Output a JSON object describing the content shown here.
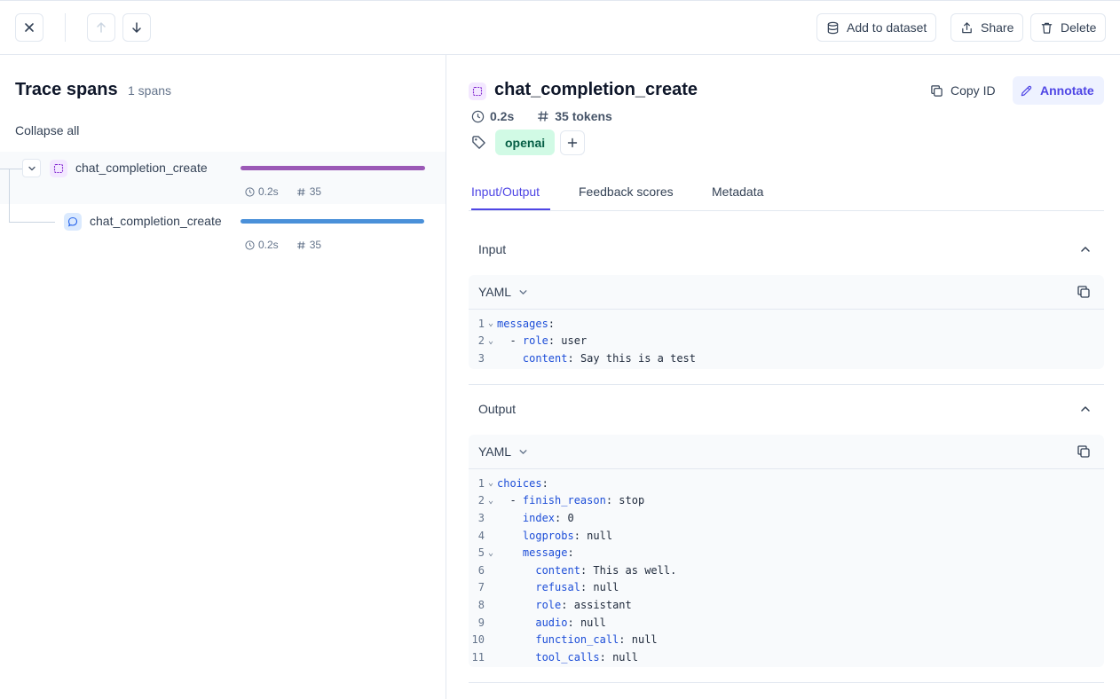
{
  "header": {
    "add_to_dataset": "Add to dataset",
    "share": "Share",
    "delete": "Delete"
  },
  "left": {
    "title": "Trace spans",
    "count": "1 spans",
    "collapse_all": "Collapse all",
    "spans": [
      {
        "name": "chat_completion_create",
        "duration": "0.2s",
        "tokens": "35",
        "bar_color": "#9b59b6",
        "progress": 1.0
      },
      {
        "name": "chat_completion_create",
        "duration": "0.2s",
        "tokens": "35",
        "bar_color": "#4a90d9",
        "progress": 1.0
      }
    ]
  },
  "detail": {
    "title": "chat_completion_create",
    "copy_id": "Copy ID",
    "annotate": "Annotate",
    "duration": "0.2s",
    "tokens": "35 tokens",
    "tag": "openai",
    "tabs": [
      "Input/Output",
      "Feedback scores",
      "Metadata"
    ],
    "input": {
      "title": "Input",
      "format": "YAML",
      "lines": [
        {
          "n": "1",
          "fold": true,
          "indent": "",
          "key": "messages",
          "value": ""
        },
        {
          "n": "2",
          "fold": true,
          "indent": "  - ",
          "key": "role",
          "value": " user"
        },
        {
          "n": "3",
          "fold": false,
          "indent": "    ",
          "key": "content",
          "value": " Say this is a test"
        }
      ]
    },
    "output": {
      "title": "Output",
      "format": "YAML",
      "lines": [
        {
          "n": "1",
          "fold": true,
          "indent": "",
          "key": "choices",
          "value": ""
        },
        {
          "n": "2",
          "fold": true,
          "indent": "  - ",
          "key": "finish_reason",
          "value": " stop"
        },
        {
          "n": "3",
          "fold": false,
          "indent": "    ",
          "key": "index",
          "value": " 0"
        },
        {
          "n": "4",
          "fold": false,
          "indent": "    ",
          "key": "logprobs",
          "value": " null"
        },
        {
          "n": "5",
          "fold": true,
          "indent": "    ",
          "key": "message",
          "value": ""
        },
        {
          "n": "6",
          "fold": false,
          "indent": "      ",
          "key": "content",
          "value": " This as well."
        },
        {
          "n": "7",
          "fold": false,
          "indent": "      ",
          "key": "refusal",
          "value": " null"
        },
        {
          "n": "8",
          "fold": false,
          "indent": "      ",
          "key": "role",
          "value": " assistant"
        },
        {
          "n": "9",
          "fold": false,
          "indent": "      ",
          "key": "audio",
          "value": " null"
        },
        {
          "n": "10",
          "fold": false,
          "indent": "      ",
          "key": "function_call",
          "value": " null"
        },
        {
          "n": "11",
          "fold": false,
          "indent": "      ",
          "key": "tool_calls",
          "value": " null"
        }
      ]
    }
  },
  "colors": {
    "accent": "#4f46e5",
    "tag_bg": "#d1fae5",
    "tag_fg": "#065f46"
  }
}
